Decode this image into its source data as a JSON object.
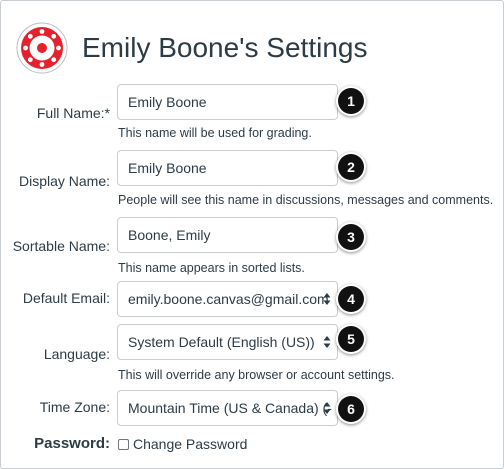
{
  "page": {
    "title": "Emily Boone's Settings"
  },
  "fields": {
    "full_name": {
      "label": "Full Name:*",
      "value": "Emily Boone",
      "help": "This name will be used for grading.",
      "callout": "1"
    },
    "display_name": {
      "label": "Display Name:",
      "value": "Emily Boone",
      "help": "People will see this name in discussions, messages and comments.",
      "callout": "2"
    },
    "sortable_name": {
      "label": "Sortable Name:",
      "value": "Boone, Emily",
      "help": "This name appears in sorted lists.",
      "callout": "3"
    },
    "default_email": {
      "label": "Default Email:",
      "value": "emily.boone.canvas@gmail.com",
      "callout": "4"
    },
    "language": {
      "label": "Language:",
      "value": "System Default (English (US))",
      "help": "This will override any browser or account settings.",
      "callout": "5"
    },
    "time_zone": {
      "label": "Time Zone:",
      "value": "Mountain Time (US & Canada) (-",
      "callout": "6"
    },
    "password": {
      "label": "Password:",
      "checkbox_label": "Change Password"
    }
  },
  "icons": {
    "logo": "canvas-logo-icon",
    "select_caret": "up-down-caret-icon",
    "checkbox": "unchecked-checkbox-icon"
  },
  "colors": {
    "logo_red": "#e4212c",
    "text": "#2d3b45",
    "border": "#c7cdd1",
    "callout": "#111111"
  }
}
